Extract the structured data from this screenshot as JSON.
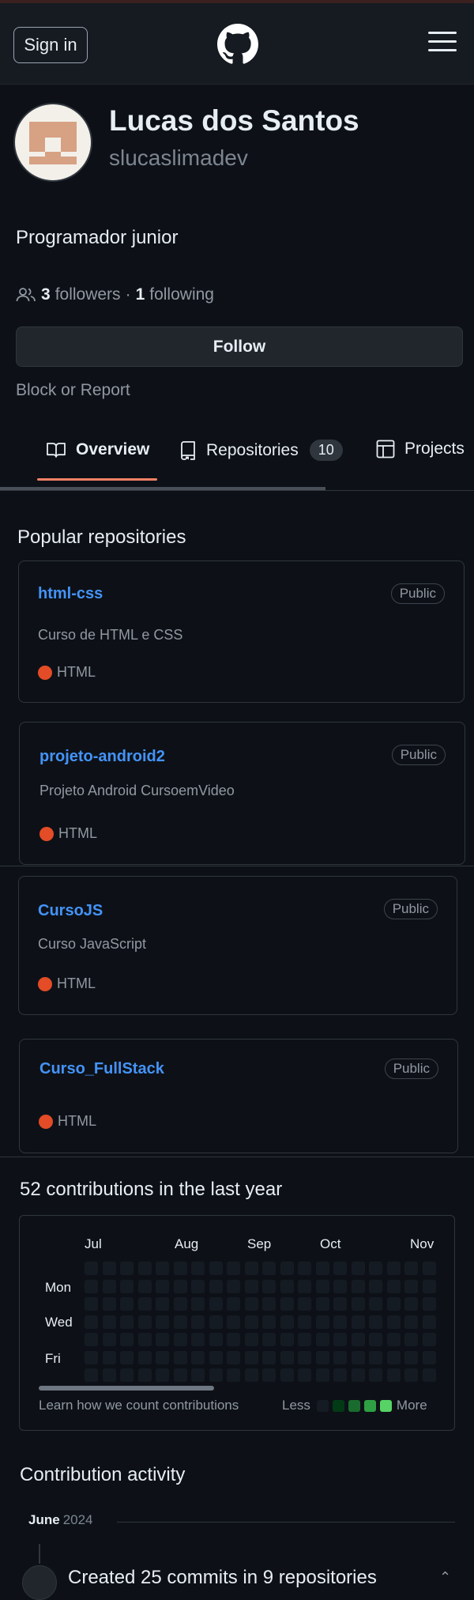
{
  "header": {
    "signin_label": "Sign in",
    "logo_icon": "github-octocat-icon",
    "menu_icon": "hamburger-menu-icon"
  },
  "profile": {
    "name": "Lucas dos Santos",
    "login": "slucaslimadev",
    "bio": "Programador junior",
    "followers_count": "3",
    "followers_label": "followers",
    "separator": "·",
    "following_count": "1",
    "following_label": "following",
    "follow_button": "Follow",
    "block_report": "Block or Report"
  },
  "tabs": [
    {
      "label": "Overview",
      "icon": "book-icon",
      "selected": true
    },
    {
      "label": "Repositories",
      "icon": "repo-icon",
      "counter": "10"
    },
    {
      "label": "Projects",
      "icon": "table-icon"
    }
  ],
  "popular": {
    "title": "Popular repositories",
    "repos": [
      {
        "name": "html-css",
        "visibility": "Public",
        "description": "Curso de HTML e CSS",
        "language": "HTML",
        "language_color": "#e34c26"
      },
      {
        "name": "projeto-android2",
        "visibility": "Public",
        "description": "Projeto Android CursoemVideo",
        "language": "HTML",
        "language_color": "#e34c26"
      },
      {
        "name": "CursoJS",
        "visibility": "Public",
        "description": "Curso JavaScript",
        "language": "HTML",
        "language_color": "#e34c26"
      },
      {
        "name": "Curso_FullStack",
        "visibility": "Public",
        "description": "",
        "language": "HTML",
        "language_color": "#e34c26"
      }
    ]
  },
  "contributions": {
    "title": "52 contributions in the last year",
    "months": [
      "Jul",
      "Aug",
      "Sep",
      "Oct",
      "Nov"
    ],
    "days": [
      "Mon",
      "Wed",
      "Fri"
    ],
    "learn_link": "Learn how we count contributions",
    "legend_less": "Less",
    "legend_more": "More",
    "legend_colors": [
      "#151b23",
      "#033a16",
      "#196c2e",
      "#2ea043",
      "#56d364"
    ]
  },
  "activity": {
    "title": "Contribution activity",
    "month": "June",
    "year": "2024",
    "summary": "Created 25 commits in 9 repositories"
  },
  "colors": {
    "background": "#0d1117",
    "link": "#4493f8",
    "tab_underline": "#f78166"
  }
}
